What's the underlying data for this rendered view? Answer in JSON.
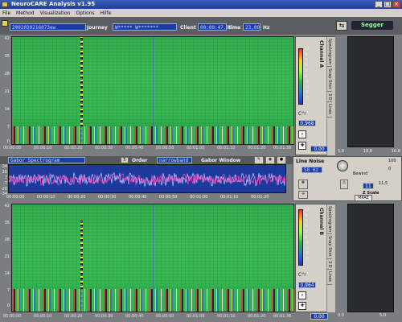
{
  "window": {
    "title": "NeuroCARE Analysis v1.95"
  },
  "menu": [
    "File",
    "Method",
    "Visualization",
    "Options",
    "Hilfe"
  ],
  "info": {
    "record_id": "2002030216073ew",
    "journey_label": "Journey",
    "journey_value": "W***** W*******",
    "client_label": "Client",
    "time_value": "00:00:47.99",
    "time_label": "time",
    "freq_value": "23,00",
    "freq_unit": "Hz"
  },
  "logo": "Segger",
  "channel_a": {
    "title": "Channel A",
    "yticks": [
      "42",
      "35",
      "28",
      "21",
      "14",
      "7",
      "0"
    ],
    "xticks": [
      "00:00:00",
      "00:00:10",
      "00:00:20",
      "00:00:30",
      "00:00:40",
      "00:00:50",
      "00:01:00",
      "00:01:10",
      "00:01:20",
      "00:01:30"
    ],
    "end_time": "00:01:36",
    "scale_ticks": [
      "11",
      "9",
      "7",
      "5",
      "3",
      "1",
      "-1",
      "-3",
      "-5",
      "-7"
    ],
    "unit": "C°r",
    "value": "0,968",
    "tabs": [
      "Spectrogram",
      "Snap Shot",
      "3 D",
      "Lines"
    ],
    "readout": "0,00"
  },
  "channel_b": {
    "title": "Channel B",
    "yticks": [
      "42",
      "35",
      "28",
      "21",
      "14",
      "7",
      "0"
    ],
    "xticks": [
      "00:00:00",
      "00:00:10",
      "00:00:20",
      "00:00:30",
      "00:00:40",
      "00:00:50",
      "00:01:00",
      "00:01:10",
      "00:01:20",
      "00:01:30"
    ],
    "end_time": "00:01:36",
    "scale_ticks": [
      "11",
      "9",
      "7",
      "5",
      "3",
      "1",
      "-1",
      "-3",
      "-5",
      "-7"
    ],
    "unit": "C°r",
    "value": "0,964",
    "tabs": [
      "Spectrogram",
      "Snap Shot",
      "3 D",
      "Lines"
    ],
    "readout": "0,00"
  },
  "middle": {
    "method": "Gabor Spectrogram",
    "order_value": "5",
    "order_label": "Order",
    "band": "narrowband",
    "window_label": "Gabor Window",
    "wave_yticks": [
      "34",
      "20",
      "7",
      "-7",
      "-20",
      "-34"
    ],
    "wave_xticks": [
      "00:00:00",
      "00:00:10",
      "00:00:20",
      "00:00:30",
      "00:00:40",
      "00:00:50",
      "00:01:00",
      "00:01:10",
      "00:01:20",
      "00:01:30"
    ]
  },
  "controls": {
    "line_noise_label": "Line Noise",
    "line_noise_value": "50 Hz",
    "mode": "Bewind",
    "range_top": "100",
    "range_bottom": "0",
    "range_mid": "11,5",
    "scale_value": "11",
    "scale_label": "Z Scale",
    "mode_button": "MPAE"
  },
  "right_header": [
    "5,8",
    "10,8",
    "16,8"
  ],
  "right_footer": [
    "0,0",
    "5,0"
  ],
  "colors": {
    "bg": "#7a7e80",
    "field": "#1a3ea8",
    "spec_green": "#2aa84a",
    "wave_bg": "#1b3a9c"
  }
}
